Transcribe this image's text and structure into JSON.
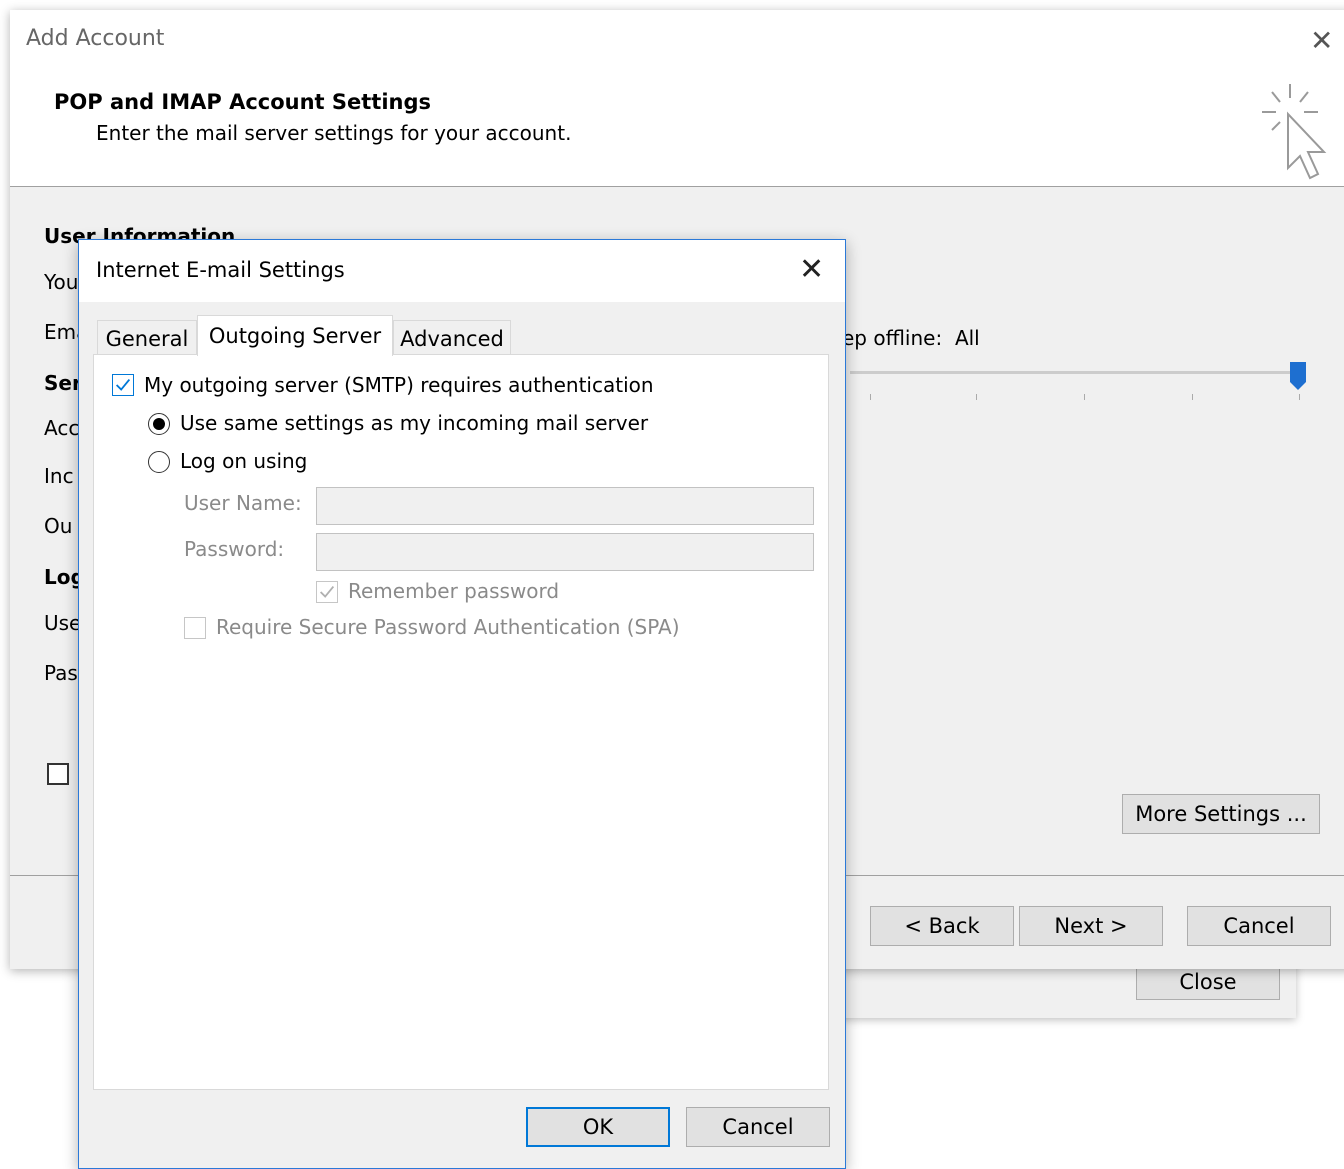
{
  "back_window": {
    "close_label": "Close"
  },
  "add_account": {
    "title": "Add Account",
    "heading": "POP and IMAP Account Settings",
    "subheading": "Enter the mail server settings for your account.",
    "section_user_information": "User Information",
    "label_your_name": "You",
    "label_email": "Ema",
    "section_server": "Ser",
    "label_account_type": "Acc",
    "label_incoming": "Inc",
    "label_outgoing": "Ou",
    "section_logon": "Log",
    "label_user_name": "Use",
    "label_password": "Pas",
    "offline_label": "ep offline:",
    "offline_value": "All",
    "more_settings_label": "More Settings ...",
    "back_label": "< Back",
    "next_label": "Next >",
    "cancel_label": "Cancel"
  },
  "internet_email_settings": {
    "title": "Internet E-mail Settings",
    "tabs": [
      {
        "label": "General",
        "active": false
      },
      {
        "label": "Outgoing Server",
        "active": true
      },
      {
        "label": "Advanced",
        "active": false
      }
    ],
    "smtp_auth_label": "My outgoing server (SMTP) requires authentication",
    "smtp_auth_checked": true,
    "same_settings_label": "Use same settings as my incoming mail server",
    "log_on_using_label": "Log on using",
    "user_name_label": "User Name:",
    "user_name_value": "",
    "password_label": "Password:",
    "password_value": "",
    "remember_password_label": "Remember password",
    "spa_label": "Require Secure Password Authentication (SPA)",
    "ok_label": "OK",
    "cancel_label": "Cancel"
  },
  "colors": {
    "accent": "#0078d7",
    "dialog_border": "#2b79d8",
    "face": "#f0f0f0"
  }
}
